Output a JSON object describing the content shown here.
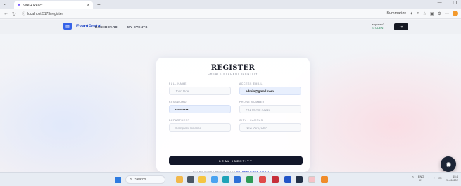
{
  "browser": {
    "tab_title": "Vite + React",
    "url": "localhost:5173/register",
    "summarize_label": "Summarize"
  },
  "app": {
    "brand": "EventPortal",
    "nav": [
      "DASHBOARD",
      "MY EVENTS"
    ],
    "user_tag": "suphssn7",
    "user_sub": "STUDENT"
  },
  "form": {
    "title": "REGISTER",
    "subtitle": "CREATE STUDENT IDENTITY",
    "fields": [
      {
        "label": "FULL NAME",
        "value": "",
        "placeholder": "John Doe"
      },
      {
        "label": "ACCESS EMAIL",
        "value": "admin@gmail.com",
        "placeholder": ""
      },
      {
        "label": "PASSWORD",
        "value": "••••••••••",
        "placeholder": ""
      },
      {
        "label": "PHONE NUMBER",
        "value": "",
        "placeholder": "+91 98765 43210"
      },
      {
        "label": "DEPARTMENT",
        "value": "",
        "placeholder": "Computer Science"
      },
      {
        "label": "CITY / CAMPUS",
        "value": "",
        "placeholder": "New York, USA"
      }
    ],
    "submit_label": "SEAL IDENTITY",
    "login_prompt": "FOUND YOUR CREDENTIALS?",
    "login_link": "AUTHENTICATE IDENTITY"
  },
  "taskbar": {
    "search_label": "Search",
    "lang": "ENG",
    "lang_sub": "IN",
    "time": "15:4",
    "date": "20-01-202"
  }
}
